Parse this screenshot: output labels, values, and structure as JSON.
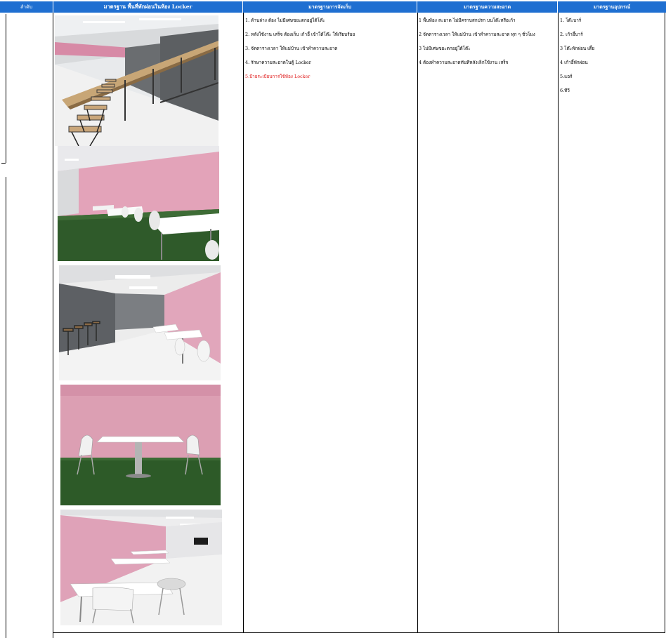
{
  "header": {
    "col_number": "ลำดับ",
    "col_area_standard": "มาตรฐาน พื้นที่พักผ่อนในห้อง Locker",
    "col_management": "มาตรฐานการจัดเก็บ",
    "col_cleanliness": "มาตรฐานความสะอาด",
    "col_equipment": "มาตรฐานอุปกรณ์"
  },
  "management_items": [
    "1. ด้านล่าง ต้อง ไม่มีเศษขยะตกอยู่ใต้โต๊ะ",
    "2. หลังใช้งาน เสร็จ ต้องเก็บ เก้าอี้ เข้าใต้โต๊ะ ให้เรียบร้อย",
    "3.  จัดตารางเวลา ให้แม่บ้าน เข้าทำความสะอาด",
    "4. รักษาความสะอาดในตู้ Locker",
    "5.ป้ายระเบียบการใช้ห้อง Locker"
  ],
  "cleanliness_items": [
    "1 พื้นห้อง สะอาด ไม่มีคราบสกปรก บนโต๊ะหรือเก้า",
    "2 จัดตารางเวลา ให้แม่บ้าน เข้าทำความสะอาด ทุก ๆ ชั่วโมง",
    "3 ไม่มีเศษขยะตกอยู่ใต้โต๊ะ",
    "4 ต้องทำความสะอาดทันทีหลังเลิกใช้งาน เสร็จ"
  ],
  "equipment_items": [
    "1. โต๊ะบาร์",
    "2. เก้าอี้บาร์",
    "3 โต๊ะพักผ่อน เตี้ย",
    "4 เก้าอี้พักผ่อน",
    "5.แอร์",
    "6.ทีวี"
  ],
  "colors": {
    "header_blue": "#1f6fd1",
    "highlight_red": "#e02020",
    "wall_pink": "#e3a3b9",
    "turf_green": "#2f5a2a"
  }
}
